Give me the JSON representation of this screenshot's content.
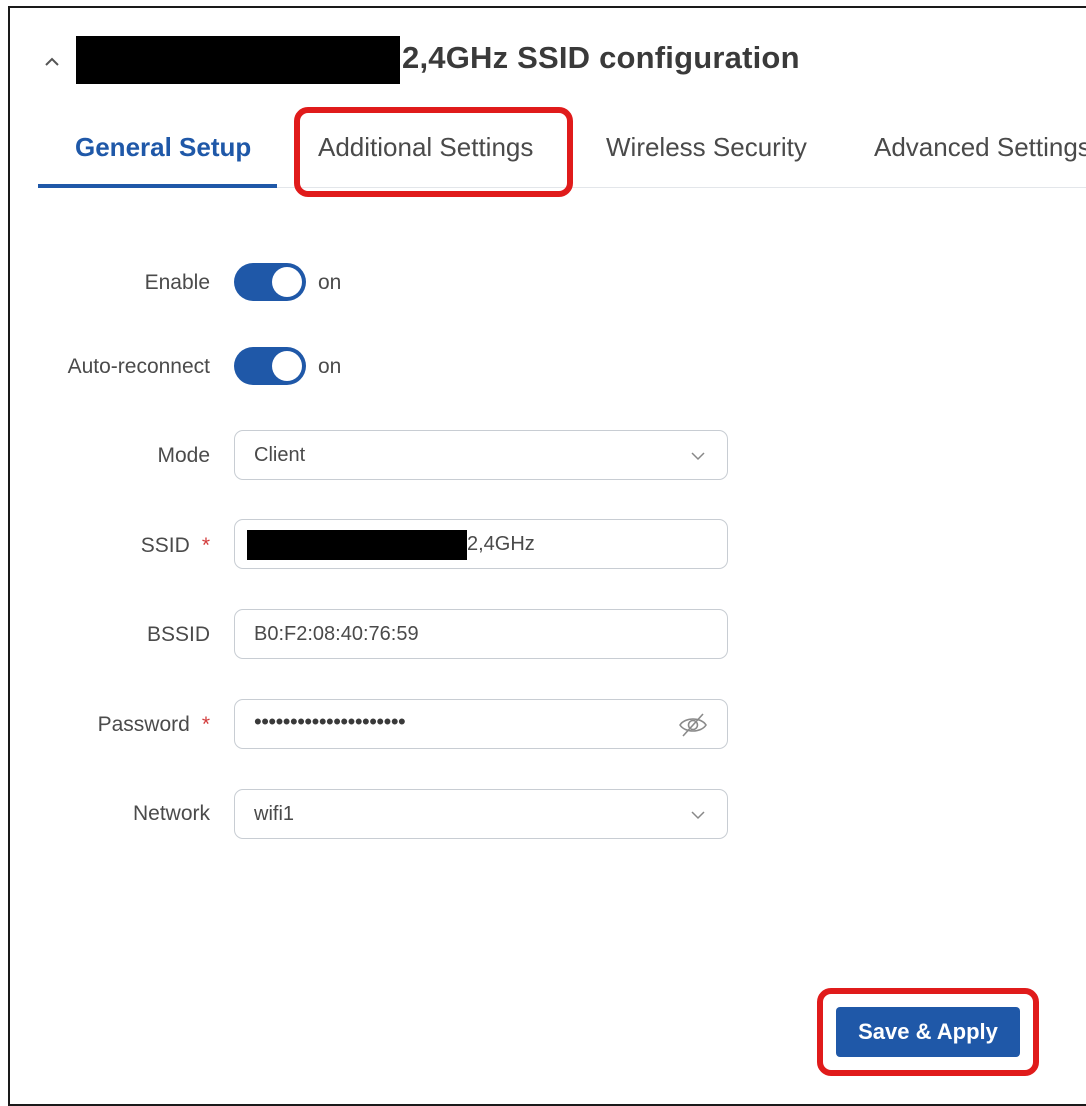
{
  "header": {
    "title": "2,4GHz SSID configuration",
    "collapse_icon": "chevron-up-icon"
  },
  "tabs": [
    {
      "label": "General Setup",
      "active": true
    },
    {
      "label": "Additional Settings",
      "active": false
    },
    {
      "label": "Wireless Security",
      "active": false
    },
    {
      "label": "Advanced Settings",
      "active": false
    }
  ],
  "form": {
    "enable": {
      "label": "Enable",
      "state": "on"
    },
    "auto_reconnect": {
      "label": "Auto-reconnect",
      "state": "on"
    },
    "mode": {
      "label": "Mode",
      "value": "Client"
    },
    "ssid": {
      "label": "SSID",
      "required_mark": "*",
      "value_suffix": "2,4GHz"
    },
    "bssid": {
      "label": "BSSID",
      "value": "B0:F2:08:40:76:59"
    },
    "password": {
      "label": "Password",
      "required_mark": "*",
      "value": "•••••••••••••••••••••"
    },
    "network": {
      "label": "Network",
      "value": "wifi1"
    }
  },
  "actions": {
    "save_label": "Save & Apply"
  },
  "colors": {
    "accent": "#1f58a8",
    "highlight": "#e01b1b"
  }
}
